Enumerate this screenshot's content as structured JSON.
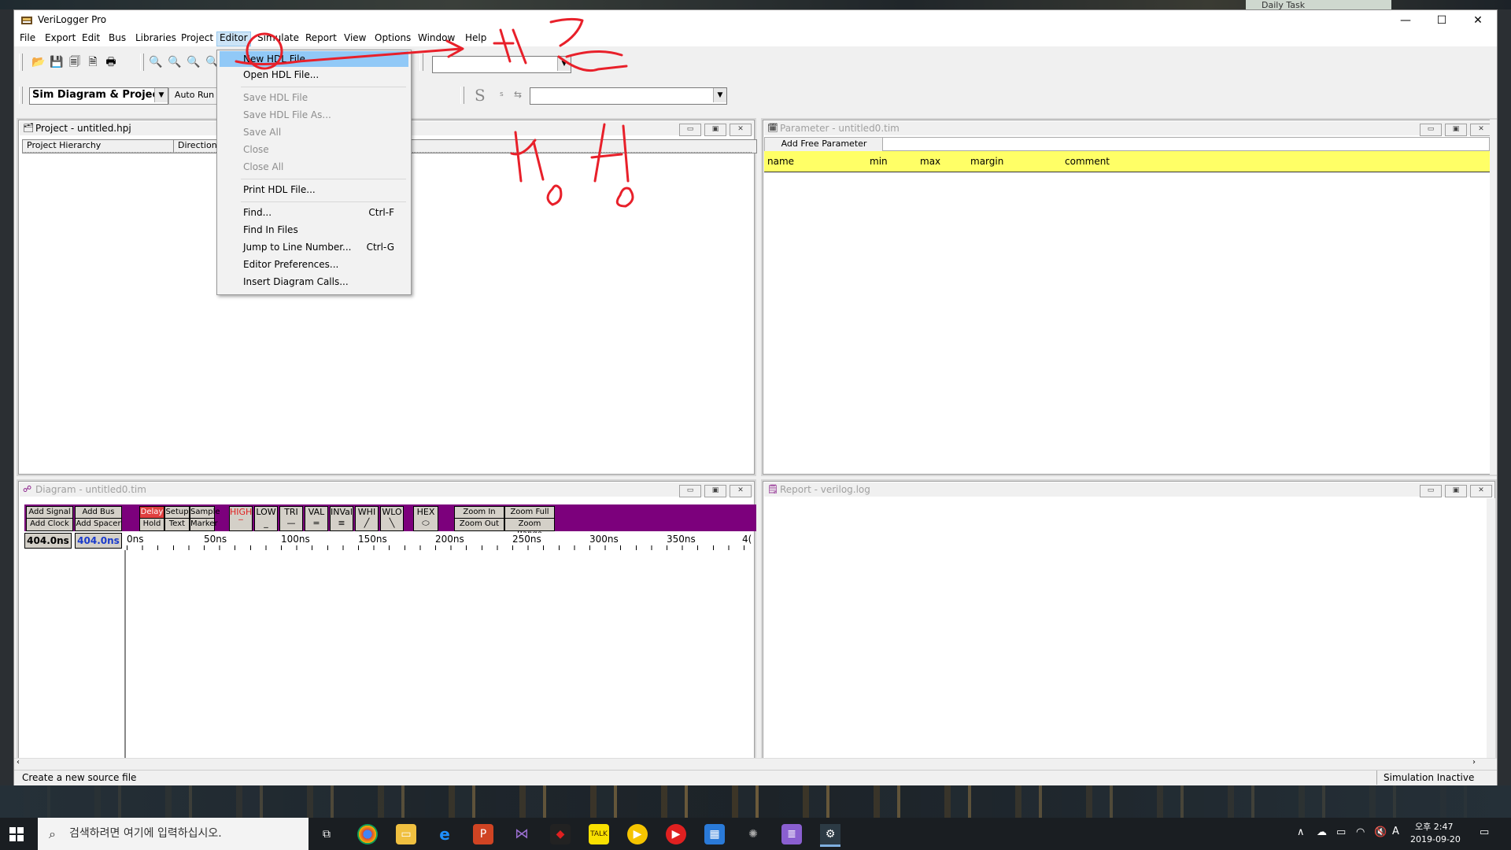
{
  "window": {
    "title": "VeriLogger Pro",
    "background_task_tab": "Daily Task",
    "controls": {
      "minimize": "—",
      "maximize": "☐",
      "close": "✕"
    }
  },
  "menubar": {
    "items": [
      "File",
      "Export",
      "Edit",
      "Bus",
      "Libraries",
      "Project",
      "Editor",
      "Simulate",
      "Report",
      "View",
      "Options",
      "Window",
      "Help"
    ],
    "active": "Editor"
  },
  "toolbar2": {
    "view_select": "Sim Diagram & Project",
    "auto_run_label": "Auto Run",
    "s_label": "S",
    "small_s": "s"
  },
  "editor_menu": {
    "items": [
      {
        "label": "New HDL File",
        "shortcut": "",
        "enabled": true,
        "highlighted": true
      },
      {
        "label": "Open HDL File...",
        "shortcut": "",
        "enabled": true
      },
      {
        "label": "Save HDL File",
        "shortcut": "",
        "enabled": false
      },
      {
        "label": "Save HDL File As...",
        "shortcut": "",
        "enabled": false
      },
      {
        "label": "Save All",
        "shortcut": "",
        "enabled": false
      },
      {
        "label": "Close",
        "shortcut": "",
        "enabled": false
      },
      {
        "label": "Close All",
        "shortcut": "",
        "enabled": false
      },
      {
        "label": "Print HDL File...",
        "shortcut": "",
        "enabled": true
      },
      {
        "label": "Find...",
        "shortcut": "Ctrl-F",
        "enabled": true
      },
      {
        "label": "Find In Files",
        "shortcut": "",
        "enabled": true
      },
      {
        "label": "Jump to Line Number...",
        "shortcut": "Ctrl-G",
        "enabled": true
      },
      {
        "label": "Editor Preferences...",
        "shortcut": "",
        "enabled": true
      },
      {
        "label": "Insert Diagram Calls...",
        "shortcut": "",
        "enabled": true
      }
    ]
  },
  "project_window": {
    "title": "Project - untitled.hpj",
    "columns": [
      "Project Hierarchy",
      "Direction"
    ]
  },
  "parameter_window": {
    "title": "Parameter - untitled0.tim",
    "add_button": "Add Free Parameter",
    "columns": [
      "name",
      "min",
      "max",
      "margin",
      "comment"
    ]
  },
  "diagram_window": {
    "title": "Diagram - untitled0.tim",
    "buttons": {
      "add_signal": "Add Signal",
      "add_bus": "Add Bus",
      "add_clock": "Add Clock",
      "add_spacer": "Add Spacer",
      "delay": "Delay",
      "setup": "Setup",
      "sample": "Sample",
      "hold": "Hold",
      "text": "Text",
      "marker": "Marker",
      "high": "HIGH",
      "low": "LOW",
      "tri": "TRI",
      "val": "VAL",
      "inval": "INVal",
      "whi": "WHI",
      "wlo": "WLO",
      "hex": "HEX",
      "zoom_in": "Zoom In",
      "zoom_full": "Zoom Full",
      "zoom_out": "Zoom Out",
      "zoom_range": "Zoom Range"
    },
    "time_left": "404.0ns",
    "time_right": "404.0ns",
    "ticks": [
      "0ns",
      "50ns",
      "100ns",
      "150ns",
      "200ns",
      "250ns",
      "300ns",
      "350ns",
      "4("
    ]
  },
  "report_window": {
    "title": "Report - verilog.log"
  },
  "statusbar": {
    "message": "Create a new source file",
    "sim_state": "Simulation Inactive"
  },
  "annotations": {
    "text1": "서강",
    "text2": "서오 서오"
  },
  "taskbar": {
    "search_placeholder": "검색하려면 여기에 입력하십시오.",
    "time": "오후 2:47",
    "date": "2019-09-20",
    "ime": "A"
  },
  "colors": {
    "diagram_toolbar": "#7c007c",
    "param_header": "#ffff66",
    "menu_highlight": "#91c9f7",
    "annotation": "#e8202a"
  }
}
